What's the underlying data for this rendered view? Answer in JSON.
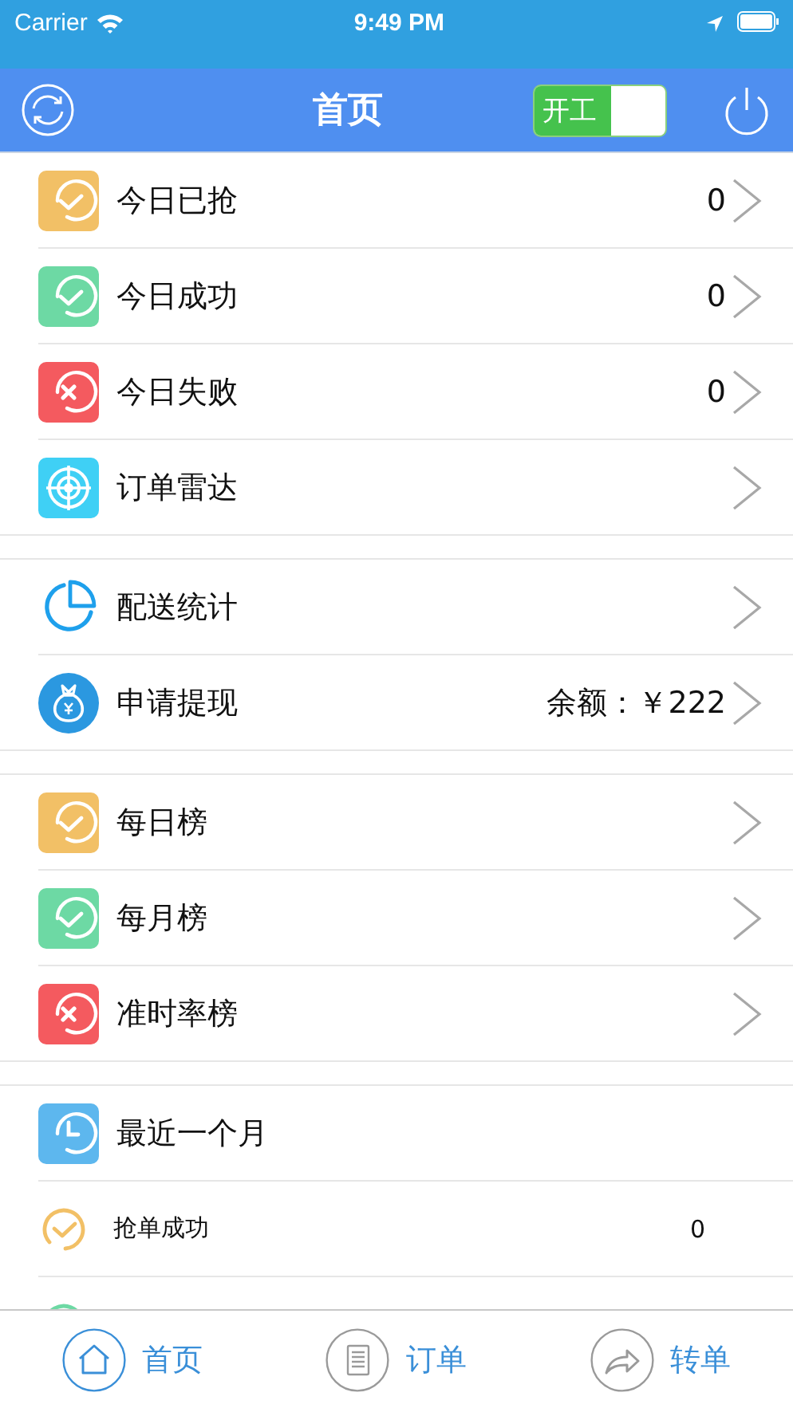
{
  "status_bar": {
    "carrier": "Carrier",
    "time": "9:49 PM"
  },
  "nav_bar": {
    "title": "首页",
    "work_switch": {
      "label": "开工",
      "on": true
    }
  },
  "sections": [
    {
      "rows": [
        {
          "kind": "check-tile",
          "color": "#f2c066",
          "label": "今日已抢",
          "value": "0",
          "chevron": true
        },
        {
          "kind": "check-tile",
          "color": "#6dd9a4",
          "label": "今日成功",
          "value": "0",
          "chevron": true
        },
        {
          "kind": "cross-tile",
          "color": "#f45a5f",
          "label": "今日失败",
          "value": "0",
          "chevron": true
        },
        {
          "kind": "radar-tile",
          "color": "#3fd0f5",
          "label": "订单雷达",
          "chevron": true
        }
      ]
    },
    {
      "rows": [
        {
          "kind": "pie",
          "color": "#1ea0ec",
          "label": "配送统计",
          "chevron": true
        },
        {
          "kind": "moneybag",
          "color": "#2b98e0",
          "label": "申请提现",
          "value": "余额：￥222",
          "chevron": true
        }
      ]
    },
    {
      "rows": [
        {
          "kind": "check-tile",
          "color": "#f2c066",
          "label": "每日榜",
          "chevron": true
        },
        {
          "kind": "check-tile",
          "color": "#6dd9a4",
          "label": "每月榜",
          "chevron": true
        },
        {
          "kind": "cross-tile",
          "color": "#f45a5f",
          "label": "准时率榜",
          "chevron": true
        }
      ]
    },
    {
      "rows": [
        {
          "kind": "clock-tile",
          "color": "#5db7ee",
          "label": "最近一个月",
          "chevron": false
        },
        {
          "kind": "check-stat",
          "color": "#f2c066",
          "label": "抢单成功",
          "value": "0",
          "chevron": false
        },
        {
          "kind": "check-stat",
          "color": "#6dd9a4",
          "chevron": false
        }
      ]
    }
  ],
  "tab_bar": [
    {
      "label": "首页",
      "selected": true
    },
    {
      "label": "订单",
      "selected": false
    },
    {
      "label": "转单",
      "selected": false
    }
  ]
}
